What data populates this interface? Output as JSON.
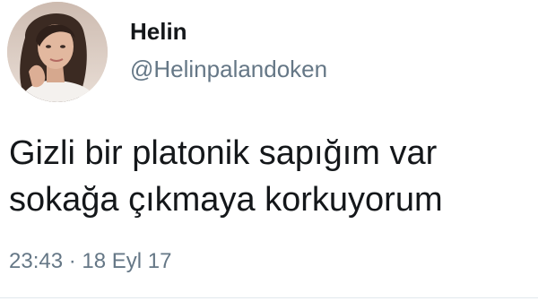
{
  "author": {
    "display_name": "Helin",
    "handle": "@Helinpalandoken"
  },
  "tweet": {
    "lines": [
      "Gizli bir platonik sapığım var",
      "sokağa çıkmaya korkuyorum"
    ],
    "time": "23:43",
    "separator": "·",
    "date": "18 Eyl 17"
  },
  "colors": {
    "text": "#14171a",
    "secondary": "#657786",
    "divider": "#e1e8ed"
  },
  "icons": {
    "avatar": "profile-photo"
  }
}
